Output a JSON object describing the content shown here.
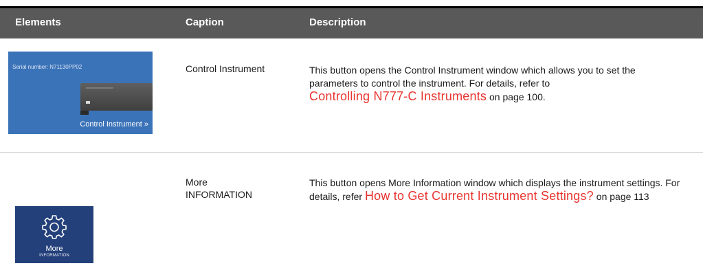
{
  "table": {
    "headers": {
      "elements": "Elements",
      "caption": "Caption",
      "description": "Description"
    },
    "rows": [
      {
        "caption": "Control Instrument",
        "description_before": "This button opens the Control Instrument window which allows you to set the parameters to control the instrument. For details, refer to",
        "link_text": "Controlling N777-C Instruments",
        "description_after": " on page 100.",
        "thumbnail": {
          "serial": "Serial number: N71130PP02",
          "button_label": "Control Instrument »",
          "background_color": "#3b73b8"
        }
      },
      {
        "caption_line1": "More",
        "caption_line2": "INFORMATION",
        "description_before": "This button opens More Information window which displays the instrument settings. For details, refer",
        "link_text": "How to Get Current Instrument Settings?",
        "description_after": " on page 113",
        "thumbnail": {
          "icon": "gear-icon",
          "label": "More",
          "sublabel": "INFORMATION",
          "background_color": "#24407a"
        }
      }
    ]
  },
  "colors": {
    "header_bg": "#595959",
    "link": "#e8332e"
  }
}
